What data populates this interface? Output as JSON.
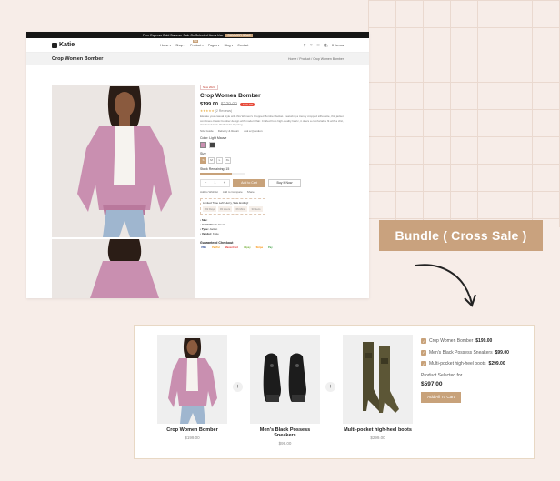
{
  "shop": {
    "promo": {
      "text": "Free Express Gold Summer Sale On Selected Items Use",
      "code": "SUMMER SALE"
    },
    "brand": "Katie",
    "menu": [
      {
        "label": "Home ▾"
      },
      {
        "label": "Shop ▾"
      },
      {
        "label": "Product ▾",
        "tag": "Hot"
      },
      {
        "label": "Pages ▾"
      },
      {
        "label": "Blog ▾"
      },
      {
        "label": "Contact"
      }
    ],
    "cart_label": "0 Items",
    "page_title": "Crop Women Bomber",
    "breadcrumb": "Home / Product / Crop Women Bomber",
    "product": {
      "badge": "New 2024",
      "title": "Crop Women Bomber",
      "price_now": "$199.00",
      "price_old": "$229.00",
      "discount": "-15% Off",
      "reviews": "(2 Reviews)",
      "description": "Elevate your casual style with this Women's Cropped Bomber Jacket. Featuring a trendy cropped silhouette, this jacket combines classic bomber design with modern flair. Crafted from high-quality fabric, it offers a comfortable fit with a chic, structured look. Perfect for layering...",
      "actions": [
        "Size Guide",
        "Delivery & Return",
        "Ask a Question"
      ],
      "color_label": "Color: Light Mauve",
      "swatch_colors": [
        "#c98fb0",
        "#444444"
      ],
      "size_label": "Size",
      "sizes": [
        "S",
        "M",
        "L",
        "XL"
      ],
      "stock_label": "Stock Remaining: 15",
      "stock_fraction": 0.7,
      "qty_minus": "−",
      "qty_value": "1",
      "qty_plus": "+",
      "add_to_cart": "Add to Cart",
      "buy_now": "Buy It Now",
      "secondary_actions": [
        "Add to Wishlist",
        "Add to Compare",
        "Share"
      ],
      "deal_title": "Limited Time Left! Hurry, Sale Ending!",
      "timer": [
        "182 Days",
        "03 Hours",
        "06 Mins",
        "33 Secs"
      ],
      "meta": [
        {
          "k": "Sku:",
          "v": ""
        },
        {
          "k": "Available:",
          "v": "In Stock"
        },
        {
          "k": "Type:",
          "v": "Jacket"
        },
        {
          "k": "Vendor:",
          "v": "Katie"
        }
      ],
      "checkout_label": "Guaranteed Checkout",
      "payments": [
        {
          "name": "VISA",
          "color": "#1a3b8b"
        },
        {
          "name": "PayPal",
          "color": "#f59c1a"
        },
        {
          "name": "MasterCard",
          "color": "#e53935"
        },
        {
          "name": "Alipay",
          "color": "#7cb342"
        },
        {
          "name": "Stripe",
          "color": "#fb8c00"
        },
        {
          "name": "Pay",
          "color": "#43a047"
        }
      ]
    }
  },
  "callout": "Bundle ( Cross Sale )",
  "bundle": {
    "products": [
      {
        "name": "Crop Women Bomber",
        "price": "$199.00"
      },
      {
        "name": "Men's Black Possess Sneakers",
        "price": "$99.00"
      },
      {
        "name": "Multi-pocket high-heel boots",
        "price": "$299.00"
      }
    ],
    "plus": "+",
    "checklist": [
      {
        "name": "Crop Women Bomber",
        "price": "$199.00"
      },
      {
        "name": "Men's Black Possess Sneakers",
        "price": "$99.00"
      },
      {
        "name": "Multi-pocket high-heel boots",
        "price": "$299.00"
      }
    ],
    "check_mark": "✓",
    "selected_label": "Product Selected for",
    "total": "$597.00",
    "add_button": "Add All To Cart"
  },
  "colors": {
    "accent": "#c8a27a",
    "jacket": "#c98fb0",
    "background": "#f7ede8"
  }
}
